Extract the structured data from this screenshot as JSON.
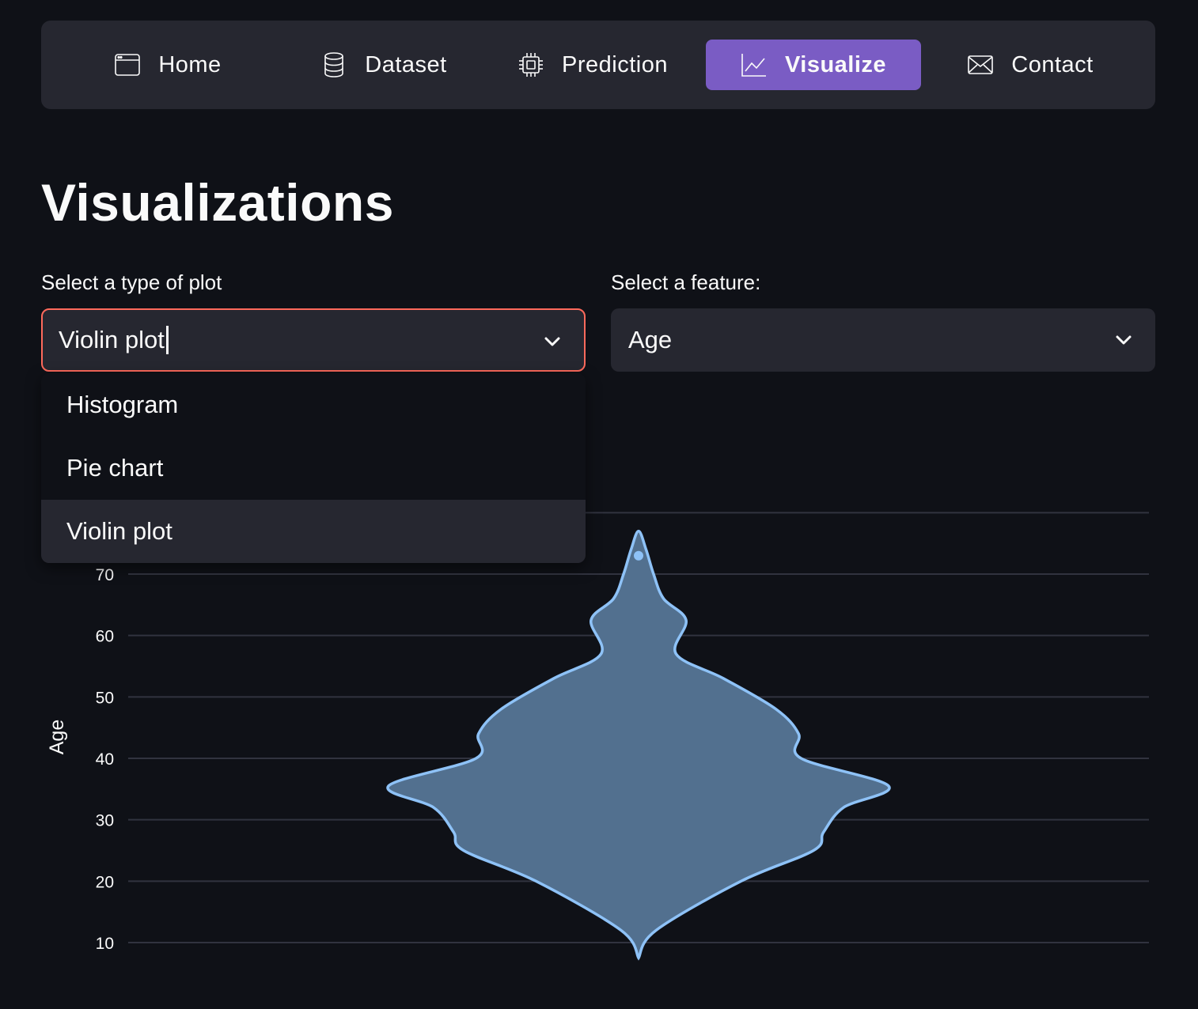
{
  "nav": {
    "items": [
      {
        "label": "Home",
        "icon": "window-icon",
        "active": false
      },
      {
        "label": "Dataset",
        "icon": "database-icon",
        "active": false
      },
      {
        "label": "Prediction",
        "icon": "cpu-icon",
        "active": false
      },
      {
        "label": "Visualize",
        "icon": "graph-up-icon",
        "active": true
      },
      {
        "label": "Contact",
        "icon": "envelope-icon",
        "active": false
      }
    ],
    "active_color": "#7a5cc4"
  },
  "page": {
    "title": "Visualizations"
  },
  "plot_type_select": {
    "label": "Select a type of plot",
    "value": "Violin plot",
    "options": [
      "Histogram",
      "Pie chart",
      "Violin plot"
    ],
    "focus_color": "#ff6a5c"
  },
  "feature_select": {
    "label": "Select a feature:",
    "value": "Age"
  },
  "chart_data": {
    "type": "violin",
    "ylabel": "Age",
    "y_ticks": [
      10,
      20,
      30,
      40,
      50,
      60,
      70
    ],
    "ylim": [
      6,
      80
    ],
    "grid": true,
    "series": [
      {
        "fill_color": "#52708f",
        "line_color": "#8ec2f7",
        "outlier_value": 73,
        "y_range": [
          7.5,
          77
        ],
        "density_profile": [
          {
            "y": 7.5,
            "w": 0
          },
          {
            "y": 12,
            "w": 0.07
          },
          {
            "y": 20,
            "w": 0.41
          },
          {
            "y": 25,
            "w": 0.7
          },
          {
            "y": 28,
            "w": 0.74
          },
          {
            "y": 32,
            "w": 0.82
          },
          {
            "y": 35.5,
            "w": 1.0
          },
          {
            "y": 40,
            "w": 0.65
          },
          {
            "y": 44,
            "w": 0.64
          },
          {
            "y": 48,
            "w": 0.55
          },
          {
            "y": 53,
            "w": 0.34
          },
          {
            "y": 57,
            "w": 0.15
          },
          {
            "y": 62.5,
            "w": 0.19
          },
          {
            "y": 66,
            "w": 0.1
          },
          {
            "y": 70,
            "w": 0.06
          },
          {
            "y": 74,
            "w": 0.03
          },
          {
            "y": 77,
            "w": 0
          }
        ]
      }
    ]
  }
}
